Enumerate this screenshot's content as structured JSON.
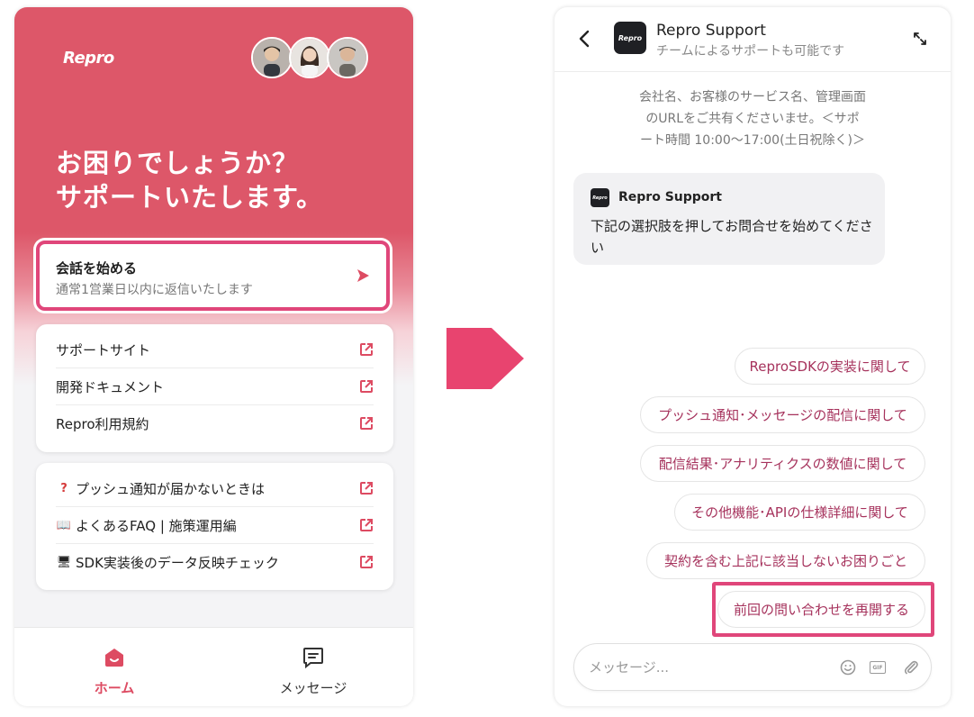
{
  "left_panel": {
    "logo": "Repro",
    "headline_line1": "お困りでしょうか？",
    "headline_line2": "サポートいたします。",
    "start_card": {
      "title": "会話を始める",
      "subtitle": "通常1営業日以内に返信いたします"
    },
    "links": [
      {
        "label": "サポートサイト"
      },
      {
        "label": "開発ドキュメント"
      },
      {
        "label": "Repro利用規約"
      }
    ],
    "articles": [
      {
        "label": "プッシュ通知が届かないときは",
        "icon": "question-mark-icon",
        "emoji": "?"
      },
      {
        "label": "よくあるFAQ | 施策運用編",
        "icon": "book-icon",
        "emoji": "📖"
      },
      {
        "label": "SDK実装後のデータ反映チェック",
        "icon": "computer-icon",
        "emoji": "🖥"
      }
    ],
    "nav": {
      "home": "ホーム",
      "messages": "メッセージ"
    }
  },
  "right_panel": {
    "title": "Repro Support",
    "subtitle": "チームによるサポートも可能です",
    "bot_logo": "Repro",
    "notice_line1": "会社名、お客様のサービス名、管理画面",
    "notice_line2": "のURLをご共有くださいませ。＜サポ",
    "notice_line3": "ート時間 10:00〜17:00(土日祝除く)＞",
    "bubble": {
      "name": "Repro Support",
      "text": "下記の選択肢を押してお問合せを始めてください"
    },
    "choices": [
      "ReproSDKの実装に関して",
      "プッシュ通知･メッセージの配信に関して",
      "配信結果･アナリティクスの数値に関して",
      "その他機能･APIの仕様詳細に関して",
      "契約を含む上記に該当しないお困りごと",
      "前回の問い合わせを再開する"
    ],
    "input_placeholder": "メッセージ...",
    "gif_label": "GIF"
  },
  "colors": {
    "brand": "#dd5769",
    "highlight": "#e0467a",
    "choice_text": "#a6325c",
    "arrow": "#e8446f"
  }
}
